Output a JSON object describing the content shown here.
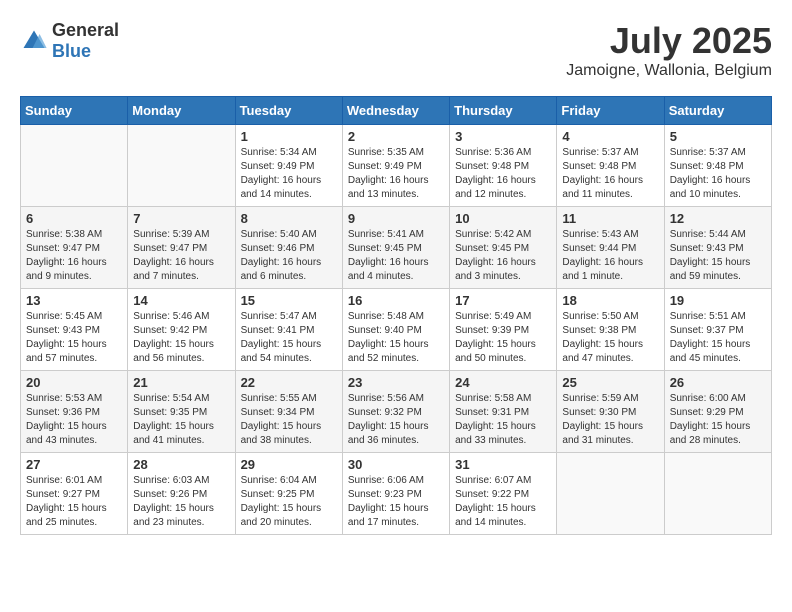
{
  "header": {
    "logo_general": "General",
    "logo_blue": "Blue",
    "month_year": "July 2025",
    "location": "Jamoigne, Wallonia, Belgium"
  },
  "weekdays": [
    "Sunday",
    "Monday",
    "Tuesday",
    "Wednesday",
    "Thursday",
    "Friday",
    "Saturday"
  ],
  "weeks": [
    [
      {
        "day": "",
        "info": ""
      },
      {
        "day": "",
        "info": ""
      },
      {
        "day": "1",
        "info": "Sunrise: 5:34 AM\nSunset: 9:49 PM\nDaylight: 16 hours and 14 minutes."
      },
      {
        "day": "2",
        "info": "Sunrise: 5:35 AM\nSunset: 9:49 PM\nDaylight: 16 hours and 13 minutes."
      },
      {
        "day": "3",
        "info": "Sunrise: 5:36 AM\nSunset: 9:48 PM\nDaylight: 16 hours and 12 minutes."
      },
      {
        "day": "4",
        "info": "Sunrise: 5:37 AM\nSunset: 9:48 PM\nDaylight: 16 hours and 11 minutes."
      },
      {
        "day": "5",
        "info": "Sunrise: 5:37 AM\nSunset: 9:48 PM\nDaylight: 16 hours and 10 minutes."
      }
    ],
    [
      {
        "day": "6",
        "info": "Sunrise: 5:38 AM\nSunset: 9:47 PM\nDaylight: 16 hours and 9 minutes."
      },
      {
        "day": "7",
        "info": "Sunrise: 5:39 AM\nSunset: 9:47 PM\nDaylight: 16 hours and 7 minutes."
      },
      {
        "day": "8",
        "info": "Sunrise: 5:40 AM\nSunset: 9:46 PM\nDaylight: 16 hours and 6 minutes."
      },
      {
        "day": "9",
        "info": "Sunrise: 5:41 AM\nSunset: 9:45 PM\nDaylight: 16 hours and 4 minutes."
      },
      {
        "day": "10",
        "info": "Sunrise: 5:42 AM\nSunset: 9:45 PM\nDaylight: 16 hours and 3 minutes."
      },
      {
        "day": "11",
        "info": "Sunrise: 5:43 AM\nSunset: 9:44 PM\nDaylight: 16 hours and 1 minute."
      },
      {
        "day": "12",
        "info": "Sunrise: 5:44 AM\nSunset: 9:43 PM\nDaylight: 15 hours and 59 minutes."
      }
    ],
    [
      {
        "day": "13",
        "info": "Sunrise: 5:45 AM\nSunset: 9:43 PM\nDaylight: 15 hours and 57 minutes."
      },
      {
        "day": "14",
        "info": "Sunrise: 5:46 AM\nSunset: 9:42 PM\nDaylight: 15 hours and 56 minutes."
      },
      {
        "day": "15",
        "info": "Sunrise: 5:47 AM\nSunset: 9:41 PM\nDaylight: 15 hours and 54 minutes."
      },
      {
        "day": "16",
        "info": "Sunrise: 5:48 AM\nSunset: 9:40 PM\nDaylight: 15 hours and 52 minutes."
      },
      {
        "day": "17",
        "info": "Sunrise: 5:49 AM\nSunset: 9:39 PM\nDaylight: 15 hours and 50 minutes."
      },
      {
        "day": "18",
        "info": "Sunrise: 5:50 AM\nSunset: 9:38 PM\nDaylight: 15 hours and 47 minutes."
      },
      {
        "day": "19",
        "info": "Sunrise: 5:51 AM\nSunset: 9:37 PM\nDaylight: 15 hours and 45 minutes."
      }
    ],
    [
      {
        "day": "20",
        "info": "Sunrise: 5:53 AM\nSunset: 9:36 PM\nDaylight: 15 hours and 43 minutes."
      },
      {
        "day": "21",
        "info": "Sunrise: 5:54 AM\nSunset: 9:35 PM\nDaylight: 15 hours and 41 minutes."
      },
      {
        "day": "22",
        "info": "Sunrise: 5:55 AM\nSunset: 9:34 PM\nDaylight: 15 hours and 38 minutes."
      },
      {
        "day": "23",
        "info": "Sunrise: 5:56 AM\nSunset: 9:32 PM\nDaylight: 15 hours and 36 minutes."
      },
      {
        "day": "24",
        "info": "Sunrise: 5:58 AM\nSunset: 9:31 PM\nDaylight: 15 hours and 33 minutes."
      },
      {
        "day": "25",
        "info": "Sunrise: 5:59 AM\nSunset: 9:30 PM\nDaylight: 15 hours and 31 minutes."
      },
      {
        "day": "26",
        "info": "Sunrise: 6:00 AM\nSunset: 9:29 PM\nDaylight: 15 hours and 28 minutes."
      }
    ],
    [
      {
        "day": "27",
        "info": "Sunrise: 6:01 AM\nSunset: 9:27 PM\nDaylight: 15 hours and 25 minutes."
      },
      {
        "day": "28",
        "info": "Sunrise: 6:03 AM\nSunset: 9:26 PM\nDaylight: 15 hours and 23 minutes."
      },
      {
        "day": "29",
        "info": "Sunrise: 6:04 AM\nSunset: 9:25 PM\nDaylight: 15 hours and 20 minutes."
      },
      {
        "day": "30",
        "info": "Sunrise: 6:06 AM\nSunset: 9:23 PM\nDaylight: 15 hours and 17 minutes."
      },
      {
        "day": "31",
        "info": "Sunrise: 6:07 AM\nSunset: 9:22 PM\nDaylight: 15 hours and 14 minutes."
      },
      {
        "day": "",
        "info": ""
      },
      {
        "day": "",
        "info": ""
      }
    ]
  ]
}
